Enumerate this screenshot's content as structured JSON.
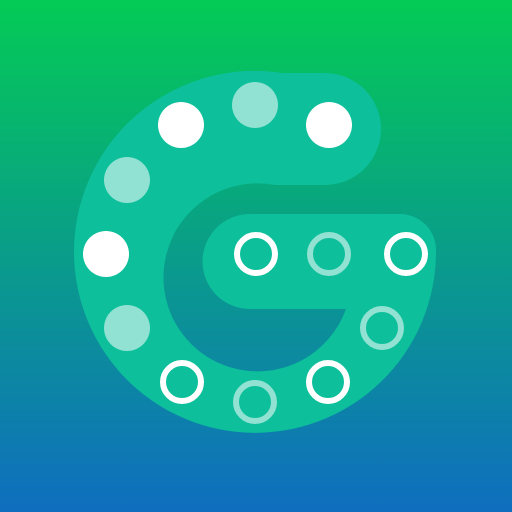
{
  "icon": {
    "name": "G dots logo",
    "colors": {
      "gradient_top": "#04CB55",
      "gradient_bottom": "#0F6EBF",
      "letter_fill": "#0DBF9B",
      "dot_solid": "#FFFFFF",
      "dot_faded": "#FFFFFF"
    },
    "dots": [
      {
        "style": "filled",
        "opacity": 1.0
      },
      {
        "style": "filled",
        "opacity": 0.55
      },
      {
        "style": "filled",
        "opacity": 1.0
      },
      {
        "style": "filled",
        "opacity": 0.55
      },
      {
        "style": "filled",
        "opacity": 1.0
      },
      {
        "style": "filled",
        "opacity": 0.55
      },
      {
        "style": "ring",
        "opacity": 1.0
      },
      {
        "style": "ring",
        "opacity": 0.55
      },
      {
        "style": "ring",
        "opacity": 1.0
      },
      {
        "style": "ring",
        "opacity": 0.55
      },
      {
        "style": "ring",
        "opacity": 1.0
      },
      {
        "style": "ring",
        "opacity": 0.55
      },
      {
        "style": "ring",
        "opacity": 1.0
      }
    ]
  }
}
